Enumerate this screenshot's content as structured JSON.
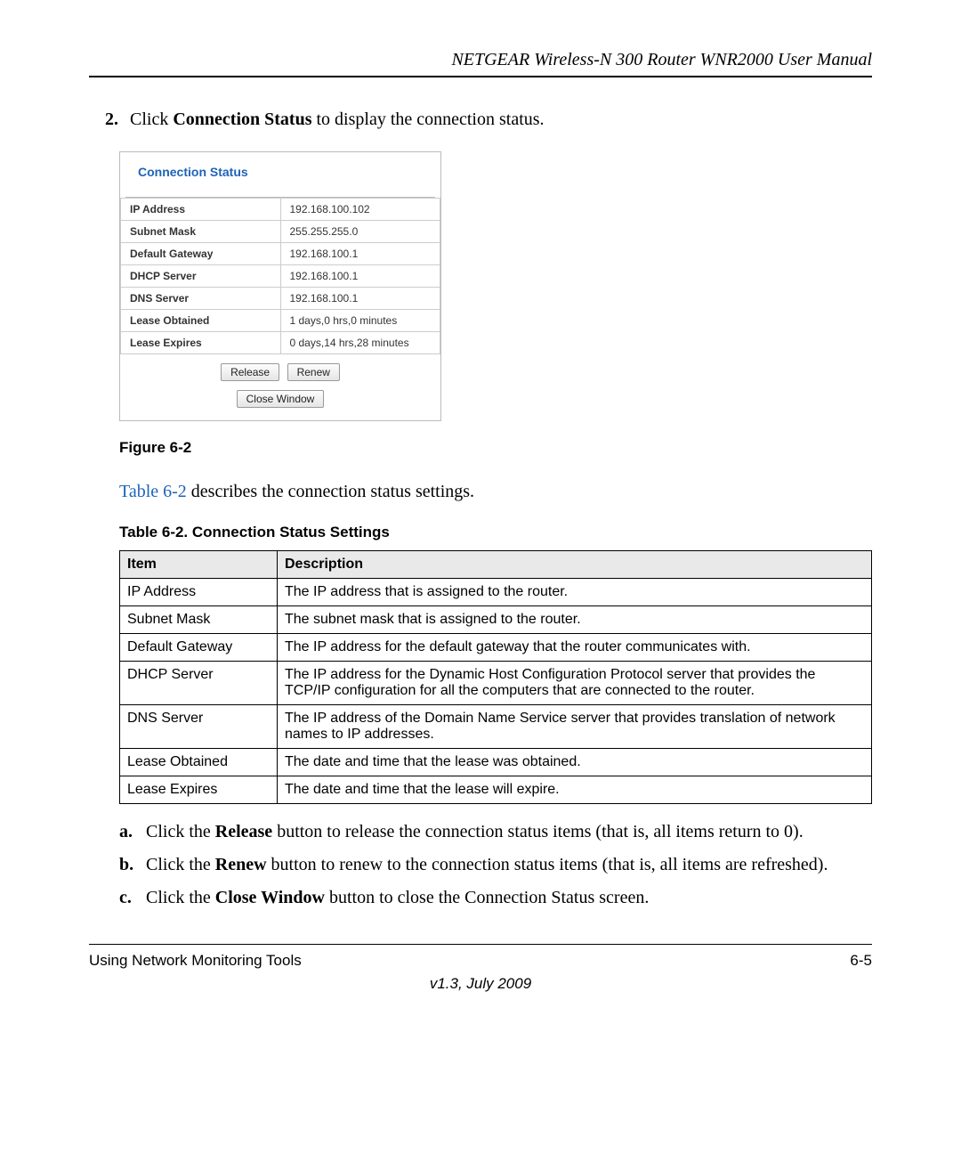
{
  "header": {
    "title": "NETGEAR Wireless-N 300 Router WNR2000 User Manual"
  },
  "step": {
    "num": "2.",
    "pre": "Click ",
    "bold": "Connection Status",
    "post": " to display the connection status."
  },
  "cs": {
    "title": "Connection Status",
    "rows": [
      {
        "label": "IP Address",
        "value": "192.168.100.102"
      },
      {
        "label": "Subnet Mask",
        "value": "255.255.255.0"
      },
      {
        "label": "Default Gateway",
        "value": "192.168.100.1"
      },
      {
        "label": "DHCP Server",
        "value": "192.168.100.1"
      },
      {
        "label": "DNS Server",
        "value": "192.168.100.1"
      },
      {
        "label": "Lease Obtained",
        "value": "1 days,0 hrs,0 minutes"
      },
      {
        "label": "Lease Expires",
        "value": "0 days,14 hrs,28 minutes"
      }
    ],
    "release_btn": "Release",
    "renew_btn": "Renew",
    "close_btn": "Close Window"
  },
  "figure_caption": "Figure 6-2",
  "table_ref": {
    "link": "Table 6-2",
    "rest": " describes the connection status settings."
  },
  "table_caption": "Table 6-2. Connection Status Settings",
  "desc_table": {
    "head": {
      "item": "Item",
      "desc": "Description"
    },
    "rows": [
      {
        "item": "IP Address",
        "desc": "The IP address that is assigned to the router."
      },
      {
        "item": "Subnet Mask",
        "desc": "The subnet mask that is assigned to the router."
      },
      {
        "item": "Default Gateway",
        "desc": "The IP address for the default gateway that the router communicates with."
      },
      {
        "item": "DHCP Server",
        "desc": "The IP address for the Dynamic Host Configuration Protocol server that provides the TCP/IP configuration for all the computers that are connected to the router."
      },
      {
        "item": "DNS Server",
        "desc": "The IP address of the Domain Name Service server that provides translation of network names to IP addresses."
      },
      {
        "item": "Lease Obtained",
        "desc": "The date and time that the lease was obtained."
      },
      {
        "item": "Lease Expires",
        "desc": "The date and time that the lease will expire."
      }
    ]
  },
  "substeps": [
    {
      "letter": "a.",
      "pre": "Click the ",
      "bold": "Release",
      "post": " button to release the connection status items (that is, all items return to 0)."
    },
    {
      "letter": "b.",
      "pre": "Click the ",
      "bold": "Renew",
      "post": " button to renew to the connection status items (that is, all items are refreshed)."
    },
    {
      "letter": "c.",
      "pre": "Click the ",
      "bold": "Close Window",
      "post": " button to close the Connection Status screen."
    }
  ],
  "footer": {
    "left": "Using Network Monitoring Tools",
    "right": "6-5",
    "center": "v1.3, July 2009"
  }
}
